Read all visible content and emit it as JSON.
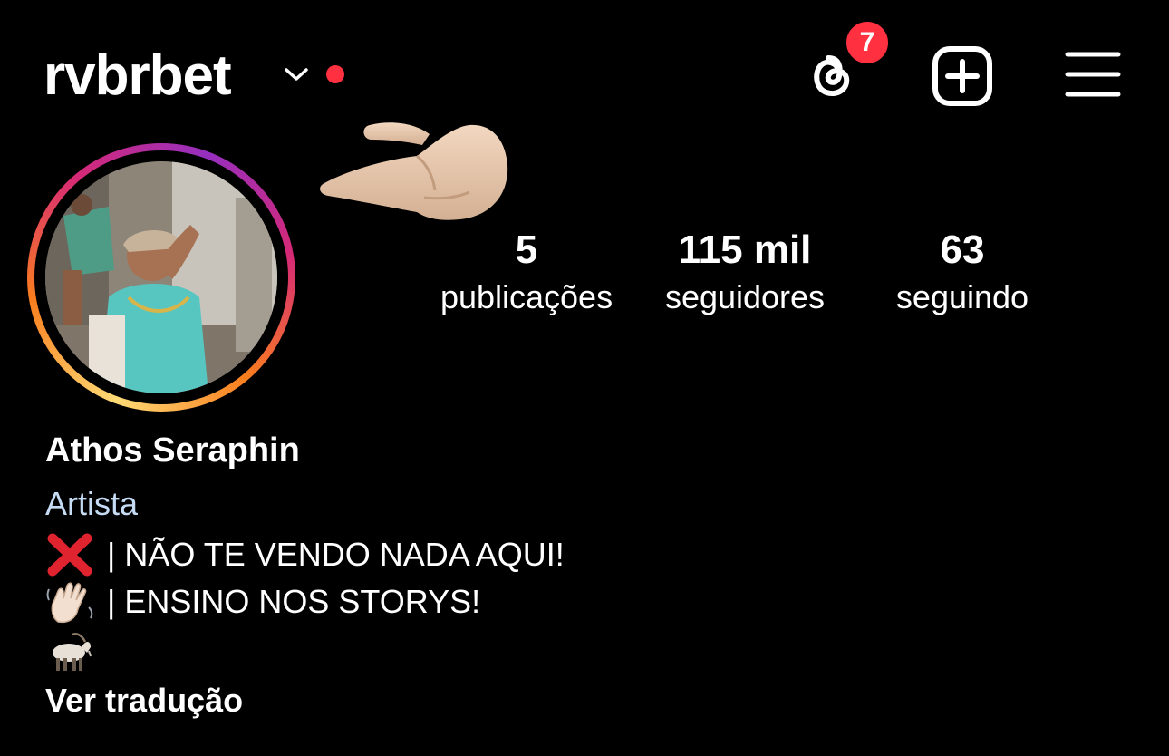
{
  "header": {
    "username": "rvbrbet",
    "threads_badge_count": "7"
  },
  "profile": {
    "stats": {
      "posts_count": "5",
      "posts_label": "publicações",
      "followers_count": "115 mil",
      "followers_label": "seguidores",
      "following_count": "63",
      "following_label": "seguindo"
    },
    "full_name": "Athos Seraphin",
    "category": "Artista",
    "bio_lines": [
      {
        "emoji": "cross-mark",
        "text": "| NÃO TE VENDO NADA AQUI!"
      },
      {
        "emoji": "waving-hand",
        "text": "| ENSINO NOS STORYS!"
      },
      {
        "emoji": "goat",
        "text": ""
      }
    ],
    "translate_link": "Ver tradução"
  },
  "colors": {
    "background": "#000000",
    "text": "#ffffff",
    "badge": "#ff3040",
    "category": "#c5dcf4"
  }
}
